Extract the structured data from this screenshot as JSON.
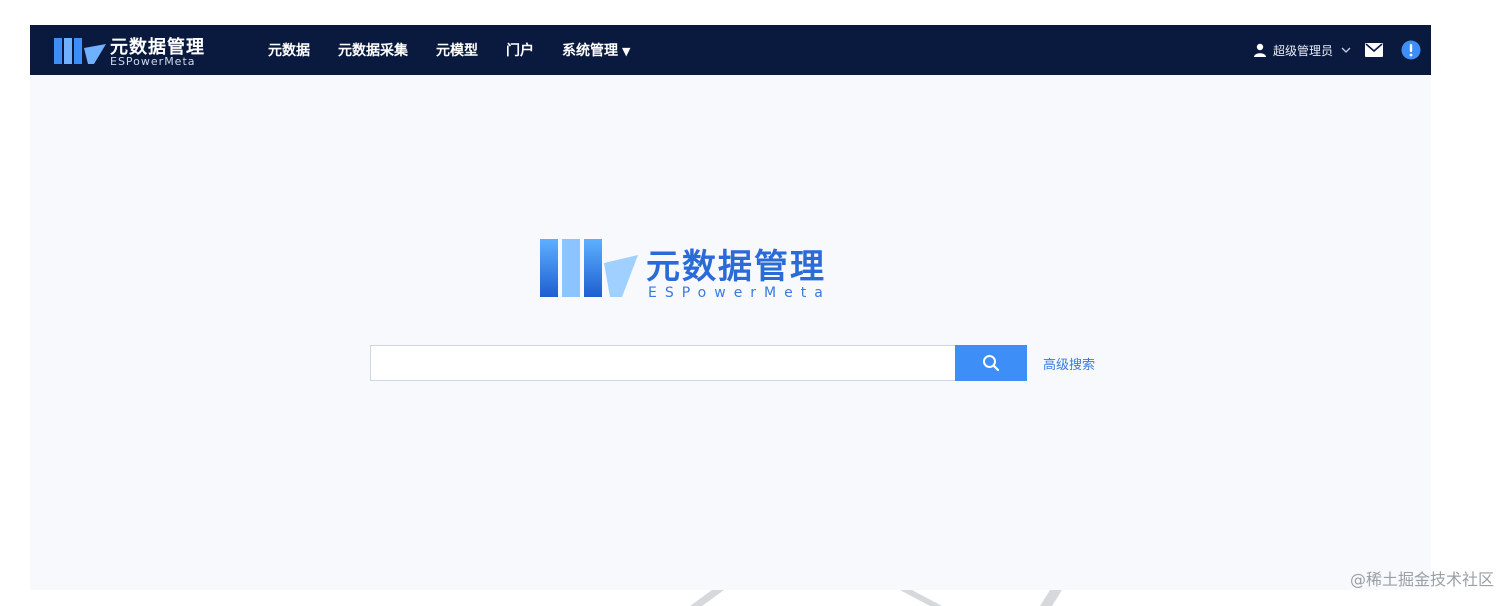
{
  "header": {
    "logo_title": "元数据管理",
    "logo_subtitle": "ESPowerMeta",
    "nav_items": [
      {
        "label": "元数据"
      },
      {
        "label": "元数据采集"
      },
      {
        "label": "元模型"
      },
      {
        "label": "门户"
      },
      {
        "label": "系统管理"
      }
    ],
    "user_name": "超级管理员",
    "icons": {
      "user": "user-icon",
      "mail": "mail-icon",
      "alert": "info-icon",
      "dropdown": "chevron-down-icon"
    }
  },
  "main": {
    "logo_title": "元数据管理",
    "logo_subtitle": "ESPowerMeta",
    "search": {
      "placeholder": "",
      "value": "",
      "button_icon": "search-icon"
    },
    "advanced_search_label": "高级搜索"
  },
  "watermark": "@稀土掘金技术社区",
  "colors": {
    "navbar_bg": "#0a1a3f",
    "accent": "#3e8ef7",
    "brand_blue": "#2a6bd8",
    "page_bg": "#f7f9fc"
  }
}
